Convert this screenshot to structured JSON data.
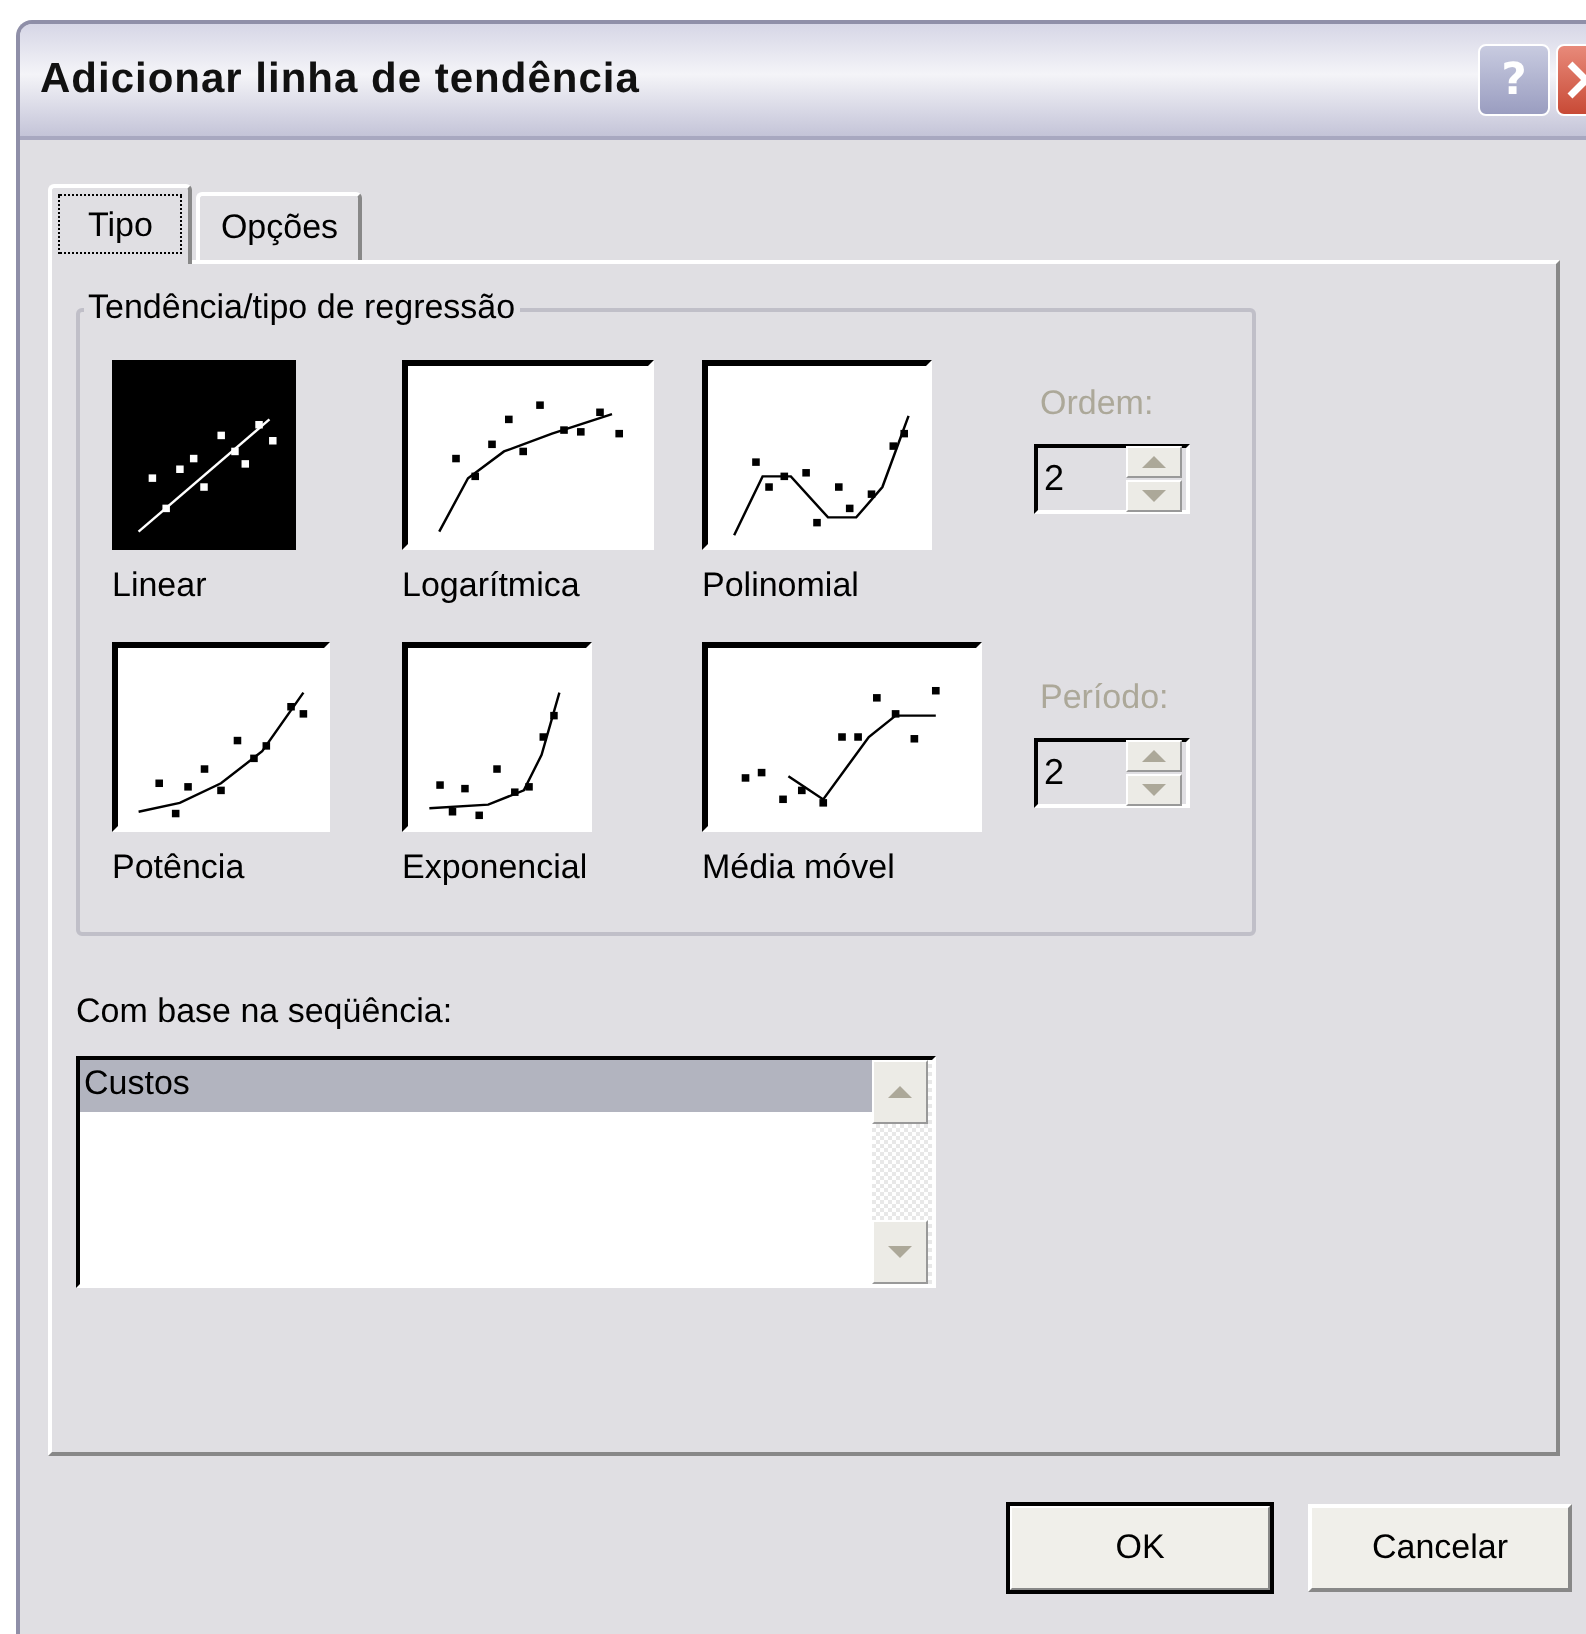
{
  "window": {
    "title": "Adicionar linha de tendência"
  },
  "title_buttons": [
    {
      "kind": "help",
      "label": "?"
    },
    {
      "kind": "close"
    }
  ],
  "tabs": [
    {
      "label": "Tipo",
      "selected": true
    },
    {
      "label": "Opções",
      "selected": false
    }
  ],
  "trend_group": {
    "title": "Tendência/tipo de regressão",
    "types": [
      {
        "kind": "linear",
        "label": "Linear",
        "selected": true
      },
      {
        "kind": "logarithmic",
        "label": "Logarítmica",
        "selected": false
      },
      {
        "kind": "polynomial",
        "label": "Polinomial",
        "selected": false
      },
      {
        "kind": "power",
        "label": "Potência",
        "selected": false
      },
      {
        "kind": "exponential",
        "label": "Exponencial",
        "selected": false
      },
      {
        "kind": "moving_average",
        "label": "Média móvel",
        "selected": false
      }
    ]
  },
  "order": {
    "label": "Ordem:",
    "value": "2",
    "disabled": true
  },
  "period": {
    "label": "Período:",
    "value": "2",
    "disabled": true
  },
  "series": {
    "label": "Com base na seqüência:",
    "items": [
      {
        "label": "Custos",
        "selected": true
      }
    ]
  },
  "buttons": [
    {
      "label": "OK",
      "default": true
    },
    {
      "label": "Cancelar",
      "default": false
    }
  ]
}
